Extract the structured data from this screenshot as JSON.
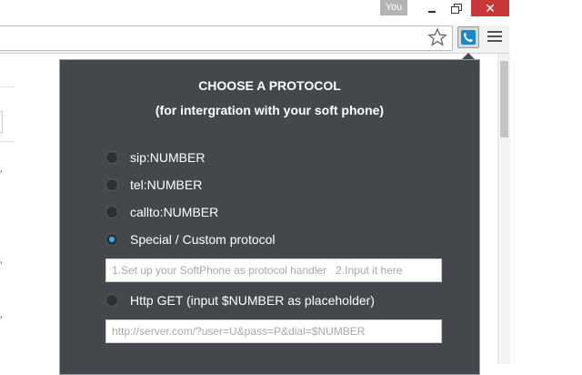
{
  "window": {
    "user_label": "You",
    "minimize_glyph": "",
    "maximize_glyph": "",
    "close_glyph": "✕"
  },
  "toolbar": {
    "icons": [
      "star-icon",
      "extension-phone-icon",
      "menu-icon"
    ]
  },
  "colors": {
    "popup_bg": "#44484d",
    "radio_accent": "#29b6e8",
    "close_red": "#c7383a"
  },
  "popup": {
    "title": "CHOOSE A PROTOCOL",
    "subtitle": "(for intergration with your soft phone)",
    "options": [
      {
        "label": "sip:NUMBER",
        "checked": false
      },
      {
        "label": "tel:NUMBER",
        "checked": false
      },
      {
        "label": "callto:NUMBER",
        "checked": false
      },
      {
        "label": "Special / Custom protocol",
        "checked": true
      }
    ],
    "custom_field": {
      "value": "",
      "placeholder": "1.Set up your SoftPhone as protocol handler   2.Input it here"
    },
    "http_option": {
      "label": "Http GET (input $NUMBER as placeholder)",
      "checked": false
    },
    "http_field": {
      "value": "",
      "placeholder": "http://server.com/?user=U&pass=P&dial=$NUMBER"
    }
  }
}
